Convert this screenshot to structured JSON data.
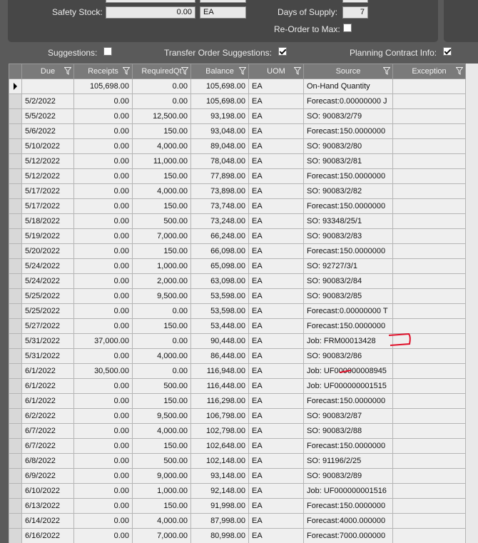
{
  "top": {
    "safety_stock_label": "Safety Stock:",
    "safety_stock_value": "0.00",
    "safety_stock_uom": "EA",
    "days_supply_label": "Days of Supply:",
    "days_supply_value": "7",
    "reorder_label": "Re-Order to Max:",
    "reorder_checked": false
  },
  "options": {
    "suggestions_label": "Suggestions:",
    "suggestions_checked": false,
    "transfer_label": "Transfer Order Suggestions:",
    "transfer_checked": true,
    "planning_label": "Planning Contract Info:",
    "planning_checked": true
  },
  "grid": {
    "columns": [
      "Due",
      "Receipts",
      "RequiredQt",
      "Balance",
      "UOM",
      "Source",
      "Exception"
    ],
    "rows": [
      [
        "",
        "105,698.00",
        "0.00",
        "105,698.00",
        "EA",
        "On-Hand Quantity",
        ""
      ],
      [
        "5/2/2022",
        "0.00",
        "0.00",
        "105,698.00",
        "EA",
        "Forecast:0.00000000 J",
        ""
      ],
      [
        "5/5/2022",
        "0.00",
        "12,500.00",
        "93,198.00",
        "EA",
        "SO: 90083/2/79",
        ""
      ],
      [
        "5/6/2022",
        "0.00",
        "150.00",
        "93,048.00",
        "EA",
        "Forecast:150.0000000",
        ""
      ],
      [
        "5/10/2022",
        "0.00",
        "4,000.00",
        "89,048.00",
        "EA",
        "SO: 90083/2/80",
        ""
      ],
      [
        "5/12/2022",
        "0.00",
        "11,000.00",
        "78,048.00",
        "EA",
        "SO: 90083/2/81",
        ""
      ],
      [
        "5/12/2022",
        "0.00",
        "150.00",
        "77,898.00",
        "EA",
        "Forecast:150.0000000",
        ""
      ],
      [
        "5/17/2022",
        "0.00",
        "4,000.00",
        "73,898.00",
        "EA",
        "SO: 90083/2/82",
        ""
      ],
      [
        "5/17/2022",
        "0.00",
        "150.00",
        "73,748.00",
        "EA",
        "Forecast:150.0000000",
        ""
      ],
      [
        "5/18/2022",
        "0.00",
        "500.00",
        "73,248.00",
        "EA",
        "SO: 93348/25/1",
        ""
      ],
      [
        "5/19/2022",
        "0.00",
        "7,000.00",
        "66,248.00",
        "EA",
        "SO: 90083/2/83",
        ""
      ],
      [
        "5/20/2022",
        "0.00",
        "150.00",
        "66,098.00",
        "EA",
        "Forecast:150.0000000",
        ""
      ],
      [
        "5/24/2022",
        "0.00",
        "1,000.00",
        "65,098.00",
        "EA",
        "SO: 92727/3/1",
        ""
      ],
      [
        "5/24/2022",
        "0.00",
        "2,000.00",
        "63,098.00",
        "EA",
        "SO: 90083/2/84",
        ""
      ],
      [
        "5/25/2022",
        "0.00",
        "9,500.00",
        "53,598.00",
        "EA",
        "SO: 90083/2/85",
        ""
      ],
      [
        "5/25/2022",
        "0.00",
        "0.00",
        "53,598.00",
        "EA",
        "Forecast:0.00000000 T",
        ""
      ],
      [
        "5/27/2022",
        "0.00",
        "150.00",
        "53,448.00",
        "EA",
        "Forecast:150.0000000",
        ""
      ],
      [
        "5/31/2022",
        "37,000.00",
        "0.00",
        "90,448.00",
        "EA",
        "Job: FRM00013428",
        ""
      ],
      [
        "5/31/2022",
        "0.00",
        "4,000.00",
        "86,448.00",
        "EA",
        "SO: 90083/2/86",
        ""
      ],
      [
        "6/1/2022",
        "30,500.00",
        "0.00",
        "116,948.00",
        "EA",
        "Job: UF000000008945",
        ""
      ],
      [
        "6/1/2022",
        "0.00",
        "500.00",
        "116,448.00",
        "EA",
        "Job: UF000000001515",
        ""
      ],
      [
        "6/1/2022",
        "0.00",
        "150.00",
        "116,298.00",
        "EA",
        "Forecast:150.0000000",
        ""
      ],
      [
        "6/2/2022",
        "0.00",
        "9,500.00",
        "106,798.00",
        "EA",
        "SO: 90083/2/87",
        ""
      ],
      [
        "6/7/2022",
        "0.00",
        "4,000.00",
        "102,798.00",
        "EA",
        "SO: 90083/2/88",
        ""
      ],
      [
        "6/7/2022",
        "0.00",
        "150.00",
        "102,648.00",
        "EA",
        "Forecast:150.0000000",
        ""
      ],
      [
        "6/8/2022",
        "0.00",
        "500.00",
        "102,148.00",
        "EA",
        "SO: 91196/2/25",
        ""
      ],
      [
        "6/9/2022",
        "0.00",
        "9,000.00",
        "93,148.00",
        "EA",
        "SO: 90083/2/89",
        ""
      ],
      [
        "6/10/2022",
        "0.00",
        "1,000.00",
        "92,148.00",
        "EA",
        "Job: UF000000001516",
        ""
      ],
      [
        "6/13/2022",
        "0.00",
        "150.00",
        "91,998.00",
        "EA",
        "Forecast:150.0000000",
        ""
      ],
      [
        "6/14/2022",
        "0.00",
        "4,000.00",
        "87,998.00",
        "EA",
        "Forecast:4000.000000",
        ""
      ],
      [
        "6/16/2022",
        "0.00",
        "7,000.00",
        "80,998.00",
        "EA",
        "Forecast:7000.000000",
        ""
      ]
    ]
  }
}
